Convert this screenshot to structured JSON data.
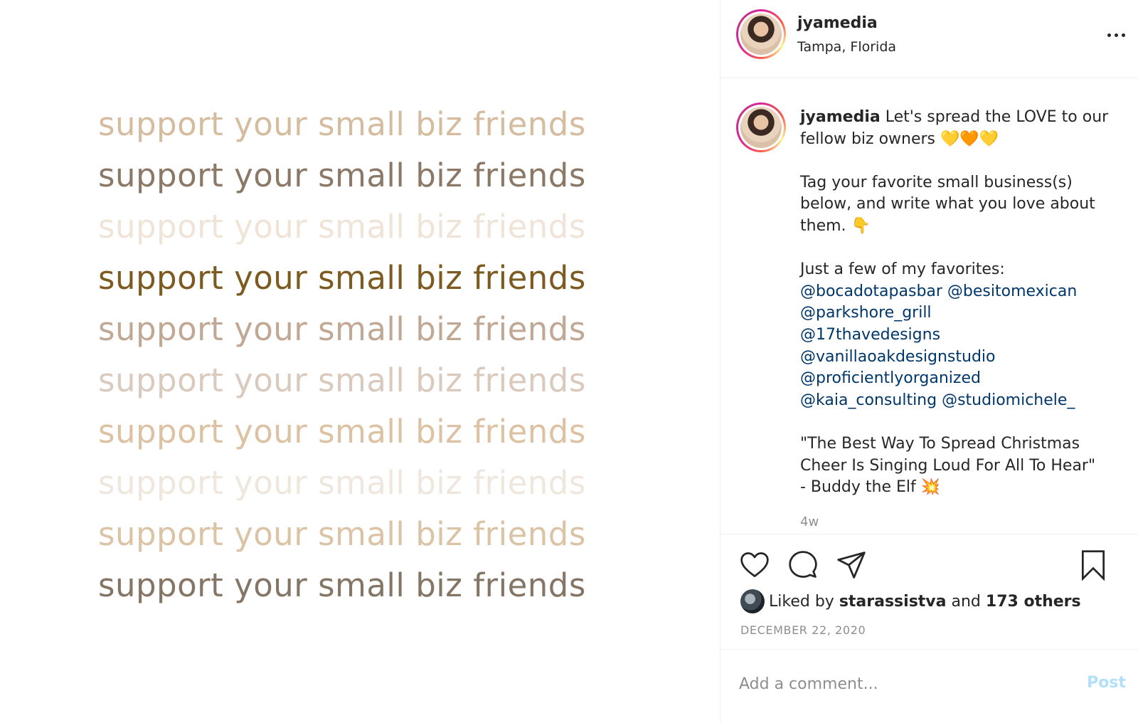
{
  "media": {
    "lines": [
      {
        "text": "support your small biz friends",
        "color": "#d5bc9e"
      },
      {
        "text": "support your small biz friends",
        "color": "#8c7866"
      },
      {
        "text": "support your small biz friends",
        "color": "#efe4d7"
      },
      {
        "text": "support your small biz friends",
        "color": "#7d5a1f"
      },
      {
        "text": "support your small biz friends",
        "color": "#c1a894"
      },
      {
        "text": "support your small biz friends",
        "color": "#d9cabd"
      },
      {
        "text": "support your small biz friends",
        "color": "#dcc2a3"
      },
      {
        "text": "support your small biz friends",
        "color": "#efe7dd"
      },
      {
        "text": "support your small biz friends",
        "color": "#dbc3a6"
      },
      {
        "text": "support your small biz friends",
        "color": "#857565"
      }
    ]
  },
  "header": {
    "username": "jyamedia",
    "location": "Tampa, Florida",
    "more_icon": "more-horizontal-icon"
  },
  "caption": {
    "username": "jyamedia",
    "lines": [
      "Let's spread the LOVE to our",
      "fellow biz owners 💛🧡💛",
      "",
      "Tag your favorite small business(s)",
      "below, and write what you love about",
      "them. 👇",
      "",
      "Just a few of my favorites:"
    ],
    "mentions": [
      "@bocadotapasbar @besitomexican",
      "@parkshore_grill",
      "@17thavedesigns",
      "@vanillaoakdesignstudio",
      "@proficientlyorganized",
      "@kaia_consulting @studiomichele_"
    ],
    "quote_lines": [
      "\"The Best Way To Spread Christmas",
      "Cheer Is Singing Loud For All To Hear\"",
      "- Buddy the Elf 💥"
    ],
    "time_ago": "4w"
  },
  "actions": {
    "icons": [
      "heart-icon",
      "comment-icon",
      "share-icon",
      "bookmark-icon"
    ],
    "liked_prefix": "Liked by",
    "liked_user": "starassistva",
    "liked_and": "and",
    "liked_others": "173 others",
    "date": "DECEMBER 22, 2020"
  },
  "comment": {
    "placeholder": "Add a comment...",
    "post_label": "Post"
  }
}
